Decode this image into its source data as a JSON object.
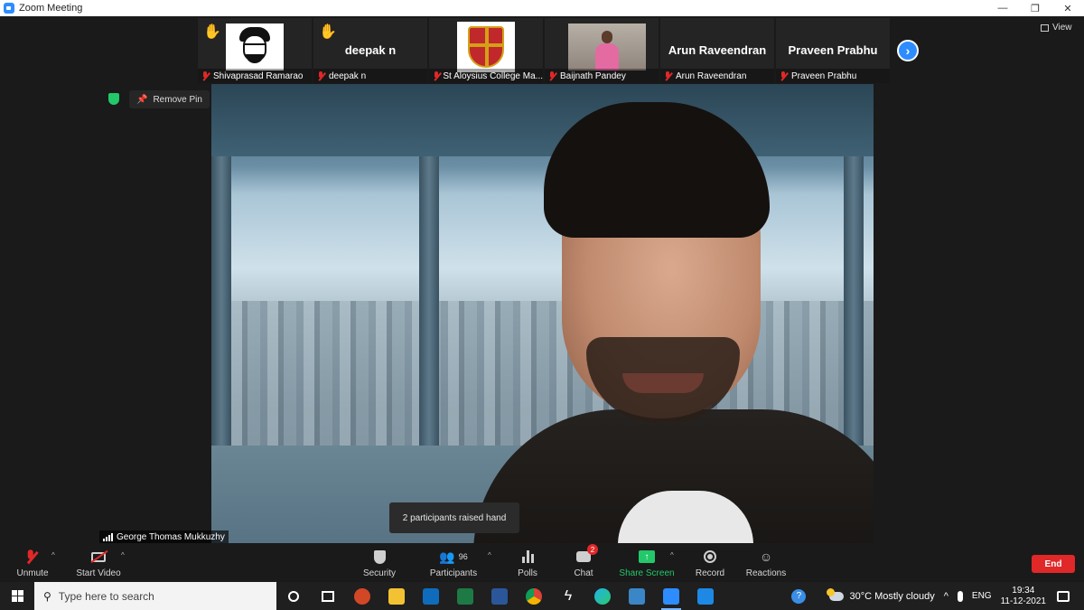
{
  "window": {
    "title": "Zoom Meeting",
    "minimize": "—",
    "restore": "❐",
    "close": "✕"
  },
  "top_strip": {
    "participants": [
      {
        "display_name": "Shivaprasad Ramarao",
        "big_label": "",
        "hand_raised": true,
        "tile": "avatar"
      },
      {
        "display_name": "deepak n",
        "big_label": "deepak n",
        "hand_raised": true,
        "tile": "name"
      },
      {
        "display_name": "St Aloysius College Ma...",
        "big_label": "",
        "hand_raised": false,
        "tile": "crest"
      },
      {
        "display_name": "Baijnath Pandey",
        "big_label": "",
        "hand_raised": false,
        "tile": "video"
      },
      {
        "display_name": "Arun Raveendran",
        "big_label": "Arun Raveendran",
        "hand_raised": false,
        "tile": "name"
      },
      {
        "display_name": "Praveen Prabhu",
        "big_label": "Praveen Prabhu",
        "hand_raised": false,
        "tile": "name"
      }
    ],
    "next_glyph": "›",
    "view_label": "View"
  },
  "pin": {
    "remove_label": "Remove Pin"
  },
  "main_video": {
    "speaker_name": "George Thomas Mukkuzhy",
    "toast": "2 participants raised hand"
  },
  "toolbar": {
    "unmute": "Unmute",
    "start_video": "Start Video",
    "security": "Security",
    "participants": "Participants",
    "participants_count": "96",
    "polls": "Polls",
    "chat": "Chat",
    "chat_badge": "2",
    "share_screen": "Share Screen",
    "record": "Record",
    "reactions": "Reactions",
    "end": "End"
  },
  "taskbar": {
    "search_placeholder": "Type here to search",
    "weather": "30°C  Mostly cloudy",
    "language": "ENG",
    "time": "19:34",
    "date": "11-12-2021"
  },
  "colors": {
    "zoom_blue": "#2d8cff",
    "end_red": "#e02828",
    "share_green": "#23c86a",
    "hand_yellow": "#f5c400"
  }
}
